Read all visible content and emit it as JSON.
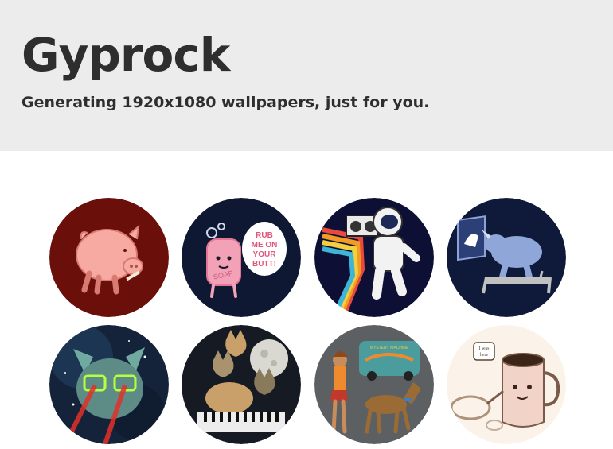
{
  "header": {
    "title": "Gyprock",
    "subtitle": "Generating 1920x1080 wallpapers, just for you."
  },
  "wallpapers": [
    {
      "subject": "pig-smoking-icon",
      "background": "#6b0f0a"
    },
    {
      "subject": "soap-bar-icon",
      "background": "#0f1833",
      "speech": [
        "RUB",
        "ME ON",
        "YOUR",
        "BUTT!"
      ],
      "soap_text": "SOAP"
    },
    {
      "subject": "astronaut-boombox-icon",
      "background": "#0d0f35"
    },
    {
      "subject": "rhino-treadmill-icon",
      "background": "#0f1a3a"
    },
    {
      "subject": "laser-cat-space-icon",
      "background": "#14233a"
    },
    {
      "subject": "cats-moon-keyboard-icon",
      "background": "#161a22"
    },
    {
      "subject": "mystery-van-dog-icon",
      "background": "#5d6063",
      "van_text": "MYSTERY MACHINE"
    },
    {
      "subject": "coffee-mug-icon",
      "background": "#fbf3ea",
      "speech": [
        "I was",
        "here"
      ]
    }
  ]
}
